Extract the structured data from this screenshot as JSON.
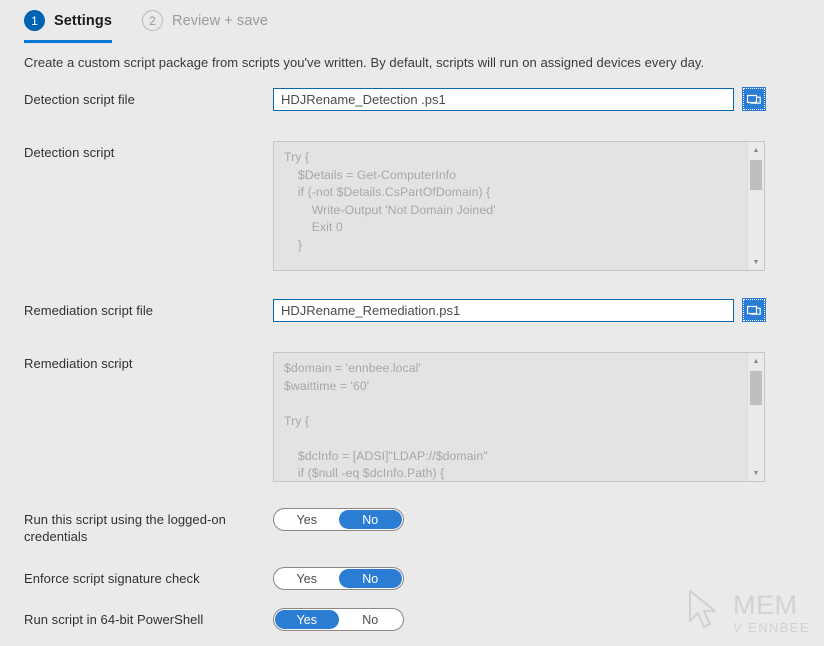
{
  "wizard": {
    "steps": [
      {
        "number": "1",
        "label": "Settings",
        "state": "active"
      },
      {
        "number": "2",
        "label": "Review + save",
        "state": "inactive"
      }
    ]
  },
  "description": "Create a custom script package from scripts you've written. By default, scripts will run on assigned devices every day.",
  "form": {
    "detection_script_file": {
      "label": "Detection script file",
      "value": "HDJRename_Detection .ps1",
      "browse_icon": "folder-browse-icon"
    },
    "detection_script": {
      "label": "Detection script",
      "code": "Try {\n    $Details = Get-ComputerInfo\n    if (-not $Details.CsPartOfDomain) {\n        Write-Output 'Not Domain Joined'\n        Exit 0\n    }",
      "scroll_up_icon": "chevron-up-icon",
      "scroll_down_icon": "chevron-down-icon"
    },
    "remediation_script_file": {
      "label": "Remediation script file",
      "value": "HDJRename_Remediation.ps1",
      "browse_icon": "folder-browse-icon"
    },
    "remediation_script": {
      "label": "Remediation script",
      "code": "$domain = 'ennbee.local'\n$waittime = '60'\n\nTry {\n\n    $dcInfo = [ADSI]\"LDAP://$domain\"\n    if ($null -eq $dcInfo.Path) {",
      "scroll_up_icon": "chevron-up-icon",
      "scroll_down_icon": "chevron-down-icon"
    },
    "toggles": [
      {
        "label": "Run this script using the logged-on credentials",
        "yes_label": "Yes",
        "no_label": "No",
        "selected": "No"
      },
      {
        "label": "Enforce script signature check",
        "yes_label": "Yes",
        "no_label": "No",
        "selected": "No"
      },
      {
        "label": "Run script in 64-bit PowerShell",
        "yes_label": "Yes",
        "no_label": "No",
        "selected": "Yes"
      }
    ]
  },
  "watermark": {
    "logo_icon": "cursor-arrow-icon",
    "main": "MEM",
    "sub_prefix": "V",
    "sub": "ENNBEE"
  },
  "colors": {
    "accent": "#0078d4",
    "toggle_on": "#2b7cd3",
    "page_bg": "#eaeaea",
    "input_border": "#0b67a8"
  }
}
